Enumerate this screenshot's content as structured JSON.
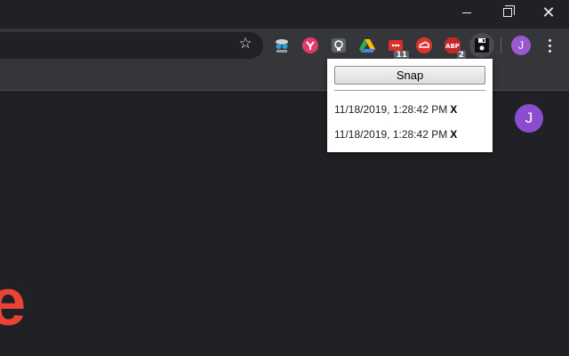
{
  "window_controls": {
    "minimize": "—",
    "maximize": "",
    "close": "✕"
  },
  "toolbar": {
    "star": "☆",
    "extensions": [
      {
        "icon": "spy-icon",
        "color": "#8a8a8a",
        "badge": ""
      },
      {
        "icon": "pink-circle-icon",
        "color": "#e5396e",
        "badge": ""
      },
      {
        "icon": "bulb-icon",
        "color": "#6b6b6b",
        "badge": ""
      },
      {
        "icon": "drive-icon",
        "color": "#34a853",
        "badge": ""
      },
      {
        "icon": "ticket-icon",
        "color": "#d93025",
        "badge": "11"
      },
      {
        "icon": "cloud-icon",
        "color": "#e0332c",
        "badge": ""
      },
      {
        "icon": "abp-icon",
        "color": "#c62828",
        "badge": "2"
      },
      {
        "icon": "floppy-icon",
        "color": "#111111",
        "badge": ""
      }
    ],
    "avatar_letter": "J"
  },
  "page": {
    "avatar_letter": "J",
    "logo_fragment": "e"
  },
  "popup": {
    "snap_label": "Snap",
    "snapshots": [
      {
        "timestamp": "11/18/2019, 1:28:42 PM",
        "delete_label": "X"
      },
      {
        "timestamp": "11/18/2019, 1:28:42 PM",
        "delete_label": "X"
      }
    ]
  }
}
